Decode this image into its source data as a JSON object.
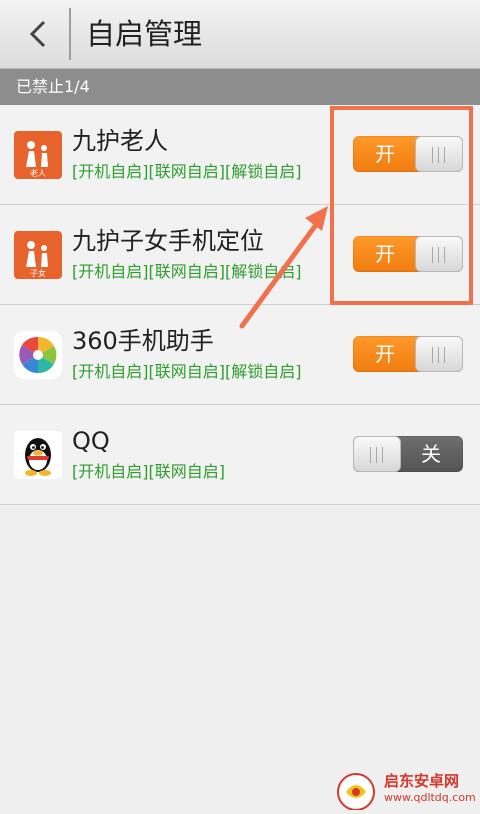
{
  "header": {
    "title": "自启管理"
  },
  "section": {
    "label": "已禁止1/4"
  },
  "apps": [
    {
      "name": "九护老人",
      "tags": "[开机自启][联网自启][解锁自启]",
      "toggle_label": "开",
      "enabled": true
    },
    {
      "name": "九护子女手机定位",
      "tags": "[开机自启][联网自启][解锁自启]",
      "toggle_label": "开",
      "enabled": true
    },
    {
      "name": "360手机助手",
      "tags": "[开机自启][联网自启][解锁自启]",
      "toggle_label": "开",
      "enabled": true
    },
    {
      "name": "QQ",
      "tags": "[开机自启][联网自启]",
      "toggle_label": "关",
      "enabled": false
    }
  ],
  "icons": {
    "app0_icon_text": "老人",
    "app1_icon_text": "子女"
  },
  "watermark": {
    "name": "启东安卓网",
    "url": "www.qdltdq.com"
  },
  "colors": {
    "toggle_on": "#f07c10",
    "toggle_off": "#5a5a5a",
    "tag_green": "#2e9e2e",
    "annotation": "#f0714c"
  }
}
